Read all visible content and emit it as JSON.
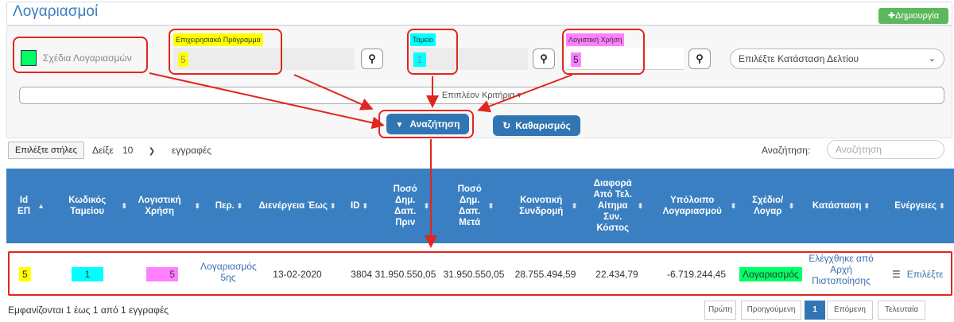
{
  "header": {
    "title": "Λογαριασμοί",
    "create_label": "✚Δημιουργία"
  },
  "filters": {
    "plans_checkbox_label": "Σχέδια Λογαριασμών",
    "program_label": "Επιχειρησιακό Πρόγραμμα",
    "program_value": "5",
    "fund_label": "Ταμείο",
    "fund_value": "1",
    "year_label": "Λογιστική Χρήση",
    "year_value": "5",
    "status_placeholder": "Επιλέξτε Κατάσταση Δελτίου",
    "more_criteria": "Επιπλέον Κριτήρια ▾",
    "search_button": "Αναζήτηση",
    "clear_button": "Καθαρισμός"
  },
  "table_controls": {
    "columns_button": "Επιλέξτε στήλες",
    "show_label": "Δείξε",
    "page_size": "10",
    "entries_label": "εγγραφές",
    "search_label": "Αναζήτηση:",
    "search_placeholder": "Αναζήτηση"
  },
  "table": {
    "columns": [
      "Id ΕΠ",
      "Κωδικός Ταμείου",
      "Λογιστική Χρήση",
      "Περ.",
      "Διενέργεια Έως",
      "ID",
      "Ποσό Δημ. Δαπ. Πριν",
      "Ποσό Δημ. Δαπ. Μετά",
      "Κοινοτική Συνδρομή",
      "Διαφορά Από Τελ. Αίτημα Συν. Κόστος",
      "Υπόλοιπο Λογαριασμού",
      "Σχέδιο/ Λογαρ",
      "Κατάσταση",
      "Ενέργειες"
    ],
    "rows": [
      {
        "id_ep": "5",
        "fund_code": "1",
        "year": "5",
        "period": "Λογαριασμός 5ης",
        "until": "13-02-2020",
        "id": "3804",
        "amount_before": "31.950.550,05",
        "amount_after": "31.950.550,05",
        "community": "28.755.494,59",
        "difference": "22.434,79",
        "balance": "-6.719.244,45",
        "plan": "Λογαριασμός",
        "status": "Ελέγχθηκε από Αρχή Πιστοποίησης",
        "action": "Επιλέξτε"
      }
    ]
  },
  "footer": {
    "info": "Εμφανίζονται 1 έως 1 από 1 εγγραφές",
    "pages": [
      "Πρώτη",
      "Προηγούμενη",
      "1",
      "Επόμενη",
      "Τελευταία"
    ]
  },
  "colors": {
    "yellow": "#ffff00",
    "cyan": "#00ffff",
    "magenta": "#ff80ff",
    "green": "#00ff66",
    "red": "#e0261f",
    "blue": "#3a7fc1"
  }
}
